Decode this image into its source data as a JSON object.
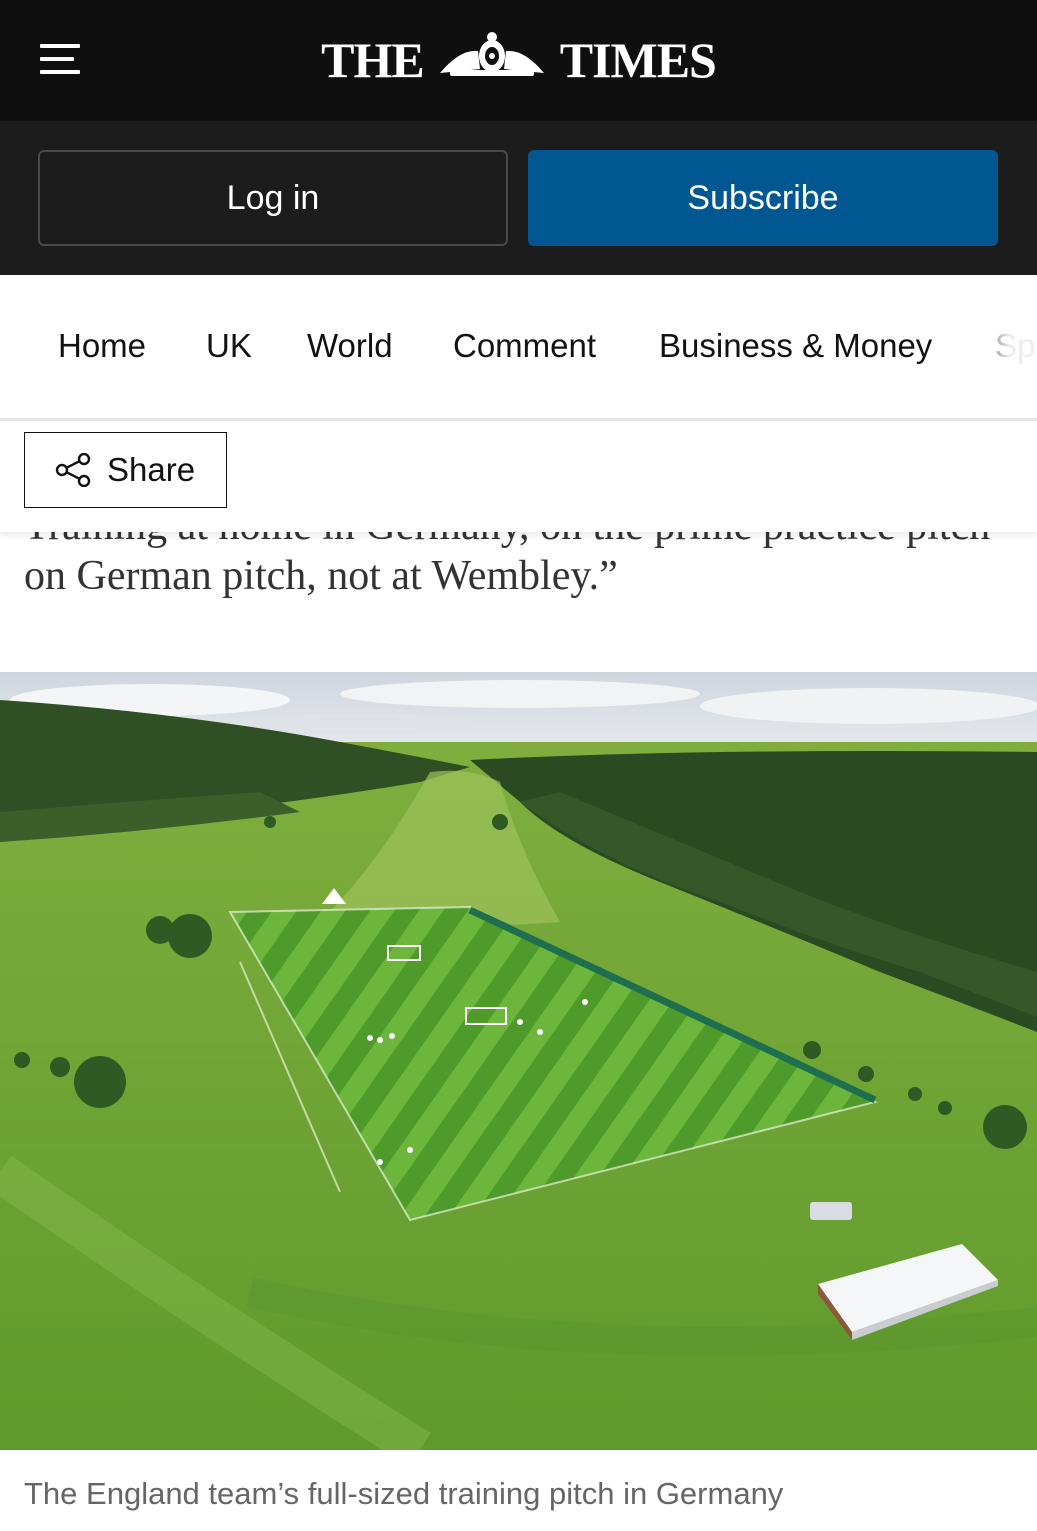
{
  "masthead": {
    "logo_left": "THE",
    "logo_right": "TIMES",
    "menu_icon": "hamburger-menu-icon",
    "crest_icon": "royal-crest-icon",
    "background_color": "#0f0f0f"
  },
  "account": {
    "login_label": "Log in",
    "subscribe_label": "Subscribe",
    "subscribe_color": "#005792"
  },
  "nav": {
    "items": [
      {
        "label": "Home"
      },
      {
        "label": "UK"
      },
      {
        "label": "World"
      },
      {
        "label": "Comment"
      },
      {
        "label": "Business & Money"
      },
      {
        "label": "Sp"
      }
    ]
  },
  "share": {
    "label": "Share",
    "icon": "share-icon"
  },
  "article": {
    "partial_line": "Training at home in Germany, on the prime practice pitch",
    "line": "on German pitch, not at Wembley.”"
  },
  "image": {
    "caption": "The England team’s full-sized training pitch in Germany"
  }
}
